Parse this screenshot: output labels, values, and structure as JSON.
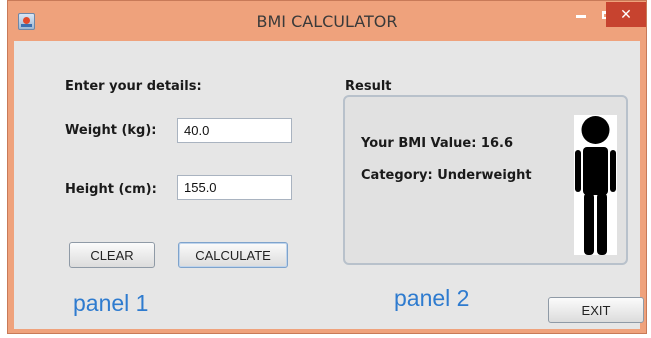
{
  "window": {
    "title": "BMI CALCULATOR",
    "minimize_glyph": "",
    "close_glyph": "✕"
  },
  "panel1": {
    "heading": "Enter your details:",
    "weight_label": "Weight (kg):",
    "weight_value": "40.0",
    "height_label": "Height (cm):",
    "height_value": "155.0",
    "clear_label": "CLEAR",
    "calculate_label": "CALCULATE",
    "caption": "panel 1"
  },
  "panel2": {
    "heading": "Result",
    "bmi_text": "Your BMI Value: 16.6",
    "category_text": "Category: Underweight",
    "figure_icon": "person-silhouette-icon",
    "caption": "panel 2"
  },
  "footer": {
    "exit_label": "EXIT"
  },
  "colors": {
    "titlebar": "#efa27c",
    "close_button": "#c7432f",
    "caption_text": "#2e7bcf"
  }
}
